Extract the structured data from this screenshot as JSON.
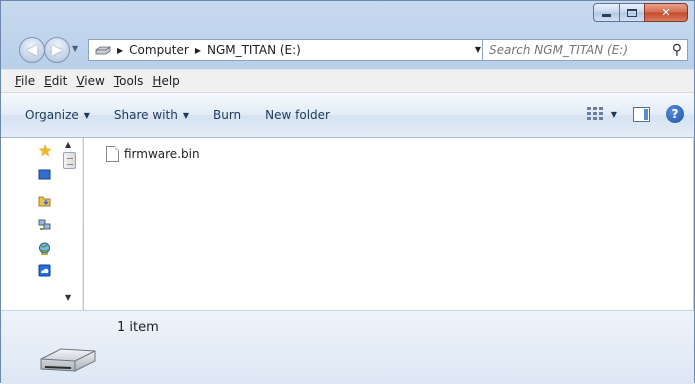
{
  "window": {
    "caption_buttons": [
      "minimize",
      "maximize",
      "close"
    ],
    "close_glyph": "✕"
  },
  "navigation": {
    "back_glyph": "◀",
    "forward_glyph": "▶",
    "breadcrumb": [
      "Computer",
      "NGM_TITAN (E:)"
    ],
    "search_placeholder": "Search NGM_TITAN (E:)"
  },
  "menubar": {
    "items": [
      {
        "accel": "F",
        "rest": "ile"
      },
      {
        "accel": "E",
        "rest": "dit"
      },
      {
        "accel": "V",
        "rest": "iew"
      },
      {
        "accel": "T",
        "rest": "ools"
      },
      {
        "accel": "H",
        "rest": "elp"
      }
    ]
  },
  "toolbar": {
    "organize": "Organize",
    "share_with": "Share with",
    "burn": "Burn",
    "new_folder": "New folder",
    "help_glyph": "?"
  },
  "files": [
    {
      "name": "firmware.bin",
      "icon": "file-icon"
    }
  ],
  "details": {
    "item_count": "1 item"
  },
  "colors": {
    "window_frame": "#b9cfe9",
    "toolbar_text": "#1e395b",
    "favorites_star": "#f2b821"
  }
}
